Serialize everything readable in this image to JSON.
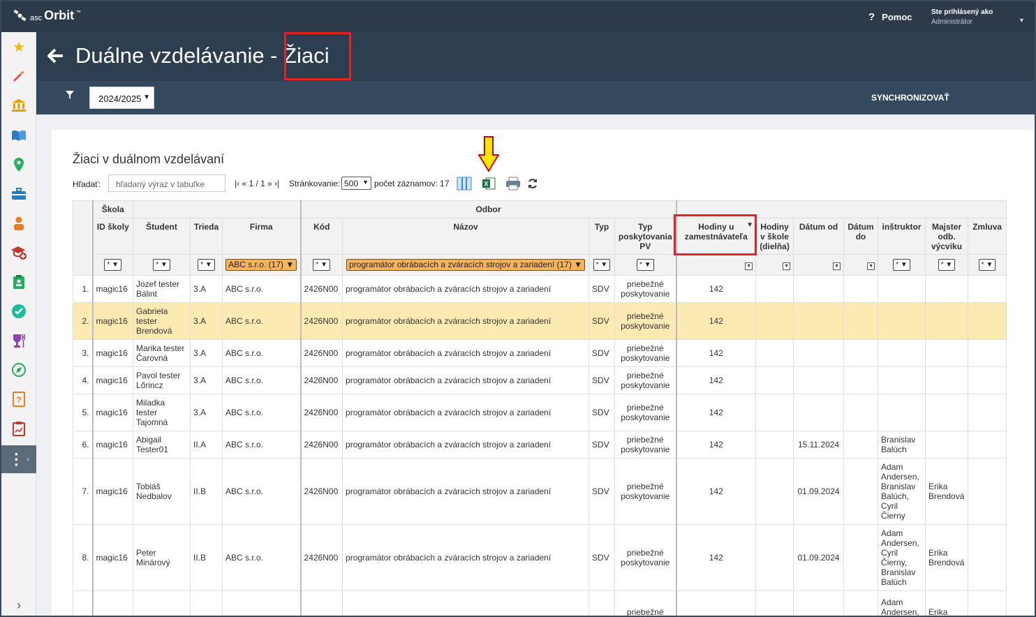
{
  "app": {
    "logo_asc": "asc",
    "logo_orbit": "Orbit",
    "logo_tm": "™"
  },
  "topbar": {
    "help_label": "Pomoc",
    "user_label": "Ste prihlásený ako",
    "user_role": "Administrátor"
  },
  "header": {
    "title_prefix": "Duálne vzdelávanie - ",
    "title_main": "Žiaci"
  },
  "filterbar": {
    "year": "2024/2025",
    "sync_label": "SYNCHRONIZOVAŤ"
  },
  "section": {
    "title": "Žiaci v duálnom vzdelávaní"
  },
  "toolbar": {
    "search_label": "Hľadať:",
    "search_placeholder": "hľadaný výraz v tabuľke",
    "pager": "|‹ « 1 / 1 » ›|",
    "paging_label": "Stránkovanie:",
    "paging_value": "500",
    "count_label": "počet záznamov: 17"
  },
  "table": {
    "groups": {
      "skola": "Škola",
      "odbor": "Odbor"
    },
    "columns": {
      "id_skoly": "ID školy",
      "student": "Študent",
      "trieda": "Trieda",
      "firma": "Firma",
      "kod": "Kód",
      "nazov": "Názov",
      "typ": "Typ",
      "typ_pv": "Typ poskytovania PV",
      "hodiny_zam": "Hodiny u zamestnávateľa",
      "hodiny_skola": "Hodiny v škole (dielňa)",
      "datum_od": "Dátum od",
      "datum_do": "Dátum do",
      "instruktor": "inštruktor",
      "majster": "Majster odb. výcviku",
      "zmluva": "Zmluva"
    },
    "filters": {
      "any": "*",
      "firma": "ABC s.r.o. (17)",
      "nazov": "programátor obrábacích a zváracích strojov a zariadení (17)"
    },
    "rows": [
      {
        "n": "1.",
        "id": "magic16",
        "student": "Jozef tester Bálint",
        "trieda": "3.A",
        "firma": "ABC s.r.o.",
        "kod": "2426N00",
        "nazov": "programátor obrábacích a zváracích strojov a zariadení",
        "typ": "SDV",
        "typ_pv": "priebežné poskytovanie",
        "hodiny": "142",
        "datum_od": "",
        "instruktor": "",
        "majster": ""
      },
      {
        "n": "2.",
        "id": "magic16",
        "student": "Gabriela tester Brendová",
        "trieda": "3.A",
        "firma": "ABC s.r.o.",
        "kod": "2426N00",
        "nazov": "programátor obrábacích a zváracích strojov a zariadení",
        "typ": "SDV",
        "typ_pv": "priebežné poskytovanie",
        "hodiny": "142",
        "datum_od": "",
        "instruktor": "",
        "majster": ""
      },
      {
        "n": "3.",
        "id": "magic16",
        "student": "Marika tester Čarovná",
        "trieda": "3.A",
        "firma": "ABC s.r.o.",
        "kod": "2426N00",
        "nazov": "programátor obrábacích a zváracích strojov a zariadení",
        "typ": "SDV",
        "typ_pv": "priebežné poskytovanie",
        "hodiny": "142",
        "datum_od": "",
        "instruktor": "",
        "majster": ""
      },
      {
        "n": "4.",
        "id": "magic16",
        "student": "Pavol tester Lőrincz",
        "trieda": "3.A",
        "firma": "ABC s.r.o.",
        "kod": "2426N00",
        "nazov": "programátor obrábacích a zváracích strojov a zariadení",
        "typ": "SDV",
        "typ_pv": "priebežné poskytovanie",
        "hodiny": "142",
        "datum_od": "",
        "instruktor": "",
        "majster": ""
      },
      {
        "n": "5.",
        "id": "magic16",
        "student": "Miladka tester Tajomná",
        "trieda": "3.A",
        "firma": "ABC s.r.o.",
        "kod": "2426N00",
        "nazov": "programátor obrábacích a zváracích strojov a zariadení",
        "typ": "SDV",
        "typ_pv": "priebežné poskytovanie",
        "hodiny": "142",
        "datum_od": "",
        "instruktor": "",
        "majster": ""
      },
      {
        "n": "6.",
        "id": "magic16",
        "student": "Abigail Tester01",
        "trieda": "II.A",
        "firma": "ABC s.r.o.",
        "kod": "2426N00",
        "nazov": "programátor obrábacích a zváracích strojov a zariadení",
        "typ": "SDV",
        "typ_pv": "priebežné poskytovanie",
        "hodiny": "142",
        "datum_od": "15.11.2024",
        "instruktor": "Branislav Balúch",
        "majster": ""
      },
      {
        "n": "7.",
        "id": "magic16",
        "student": "Tobiáš Nedbalov",
        "trieda": "II.B",
        "firma": "ABC s.r.o.",
        "kod": "2426N00",
        "nazov": "programátor obrábacích a zváracích strojov a zariadení",
        "typ": "SDV",
        "typ_pv": "priebežné poskytovanie",
        "hodiny": "142",
        "datum_od": "01.09.2024",
        "instruktor": "Adam Andersen, Branislav Balúch, Cyril Čierny",
        "majster": "Erika Brendová"
      },
      {
        "n": "8.",
        "id": "magic16",
        "student": "Peter Minárový",
        "trieda": "II.B",
        "firma": "ABC s.r.o.",
        "kod": "2426N00",
        "nazov": "programátor obrábacích a zváracích strojov a zariadení",
        "typ": "SDV",
        "typ_pv": "priebežné poskytovanie",
        "hodiny": "142",
        "datum_od": "01.09.2024",
        "instruktor": "Adam Andersen, Cyril Čierny, Branislav Balúch",
        "majster": "Erika Brendová"
      },
      {
        "n": "",
        "id": "",
        "student": "",
        "trieda": "",
        "firma": "",
        "kod": "",
        "nazov": "",
        "typ": "",
        "typ_pv": "priebežné",
        "hodiny": "",
        "datum_od": "",
        "instruktor": "Adam Andersen, C",
        "majster": "Erika"
      }
    ]
  },
  "sidebar_icons": [
    "star-icon",
    "magic-wand-icon",
    "bank-icon",
    "book-icon",
    "location-pin-icon",
    "briefcase-icon",
    "student-icon",
    "graduation-add-icon",
    "clipboard-user-icon",
    "check-circle-icon",
    "trophy-icon",
    "compass-icon",
    "question-doc-icon",
    "report-doc-icon",
    "more-icon"
  ]
}
